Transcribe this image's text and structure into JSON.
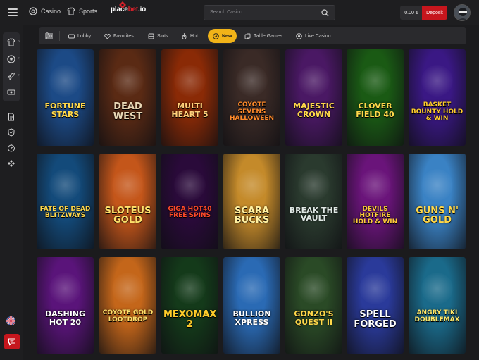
{
  "header": {
    "casino_label": "Casino",
    "sports_label": "Sports",
    "logo_text": "place",
    "logo_accent": "bet",
    "logo_suffix": ".io",
    "search_placeholder": "Search Casino",
    "balance": "0.00 €",
    "deposit_label": "Deposit"
  },
  "categories": [
    {
      "label": "Lobby",
      "icon": "ticket-icon"
    },
    {
      "label": "Favorites",
      "icon": "heart-icon"
    },
    {
      "label": "Slots",
      "icon": "slots-icon"
    },
    {
      "label": "Hot",
      "icon": "flame-icon"
    },
    {
      "label": "New",
      "icon": "new-badge-icon"
    },
    {
      "label": "Table Games",
      "icon": "cards-icon"
    },
    {
      "label": "Live Casino",
      "icon": "live-icon"
    }
  ],
  "active_category": "New",
  "games": [
    {
      "title": "FORTUNE STARS",
      "bg": "#1c4a86",
      "color": "#ffd84a"
    },
    {
      "title": "DEAD WEST",
      "bg": "#5a2a14",
      "color": "#e8d6b4"
    },
    {
      "title": "MULTI HEART 5",
      "bg": "#8a2a06",
      "color": "#ffd07a"
    },
    {
      "title": "COYOTE SEVENS HALLOWEEN",
      "bg": "#3a2a26",
      "color": "#ff8a2a"
    },
    {
      "title": "Majestic Crown",
      "bg": "#4a1864",
      "color": "#ffd84a"
    },
    {
      "title": "CLOVER FIELD 40",
      "bg": "#1a5a14",
      "color": "#ffd84a"
    },
    {
      "title": "BASKET BOUNTY HOLD & WIN",
      "bg": "#3a1884",
      "color": "#ffcc2a"
    },
    {
      "title": "FATE OF DEAD BLITZWAYS",
      "bg": "#134a7a",
      "color": "#ffd84a"
    },
    {
      "title": "SLOTEUS GOLD",
      "bg": "#c4561a",
      "color": "#ffe06a"
    },
    {
      "title": "GIGA HOT40 FREE SPINS",
      "bg": "#2a0a3a",
      "color": "#ff4a2a"
    },
    {
      "title": "SCARA BUCKS",
      "bg": "#c48a2a",
      "color": "#fff0a0"
    },
    {
      "title": "BREAK THE VAULT",
      "bg": "#2a3a2e",
      "color": "#dfe8e4"
    },
    {
      "title": "DEVILS HOTFIRE HOLD & WIN",
      "bg": "#6a147a",
      "color": "#ffcc3a"
    },
    {
      "title": "GUNS N' GOLD",
      "bg": "#3a82c4",
      "color": "#ffd84a"
    },
    {
      "title": "DASHING HOT 20",
      "bg": "#5a147a",
      "color": "#ffffff"
    },
    {
      "title": "COYOTE GOLD LOOTDROP",
      "bg": "#c4661a",
      "color": "#ffe06a"
    },
    {
      "title": "MEXOMAX 2",
      "bg": "#143a1a",
      "color": "#ffcc2a"
    },
    {
      "title": "BULLION XPRESS",
      "bg": "#2a6ab4",
      "color": "#ffffff"
    },
    {
      "title": "Gonzo's Quest II",
      "bg": "#2a4a26",
      "color": "#ffd84a"
    },
    {
      "title": "SPELL FORGED",
      "bg": "#2a3a9a",
      "color": "#ffffff"
    },
    {
      "title": "ANGRY TIKI DOUBLEMAX",
      "bg": "#1a6a8a",
      "color": "#ffe86a"
    }
  ],
  "sidebar": {
    "top_icons": [
      "shirt-icon",
      "soccer-ball-icon",
      "rocket-icon",
      "cash-icon"
    ],
    "mid_icons": [
      "document-icon",
      "shield-icon",
      "speedometer-icon",
      "chips-icon"
    ],
    "language_icon": "uk-flag-icon",
    "chat_icon": "chat-icon",
    "logout_icon": "logout-icon"
  }
}
